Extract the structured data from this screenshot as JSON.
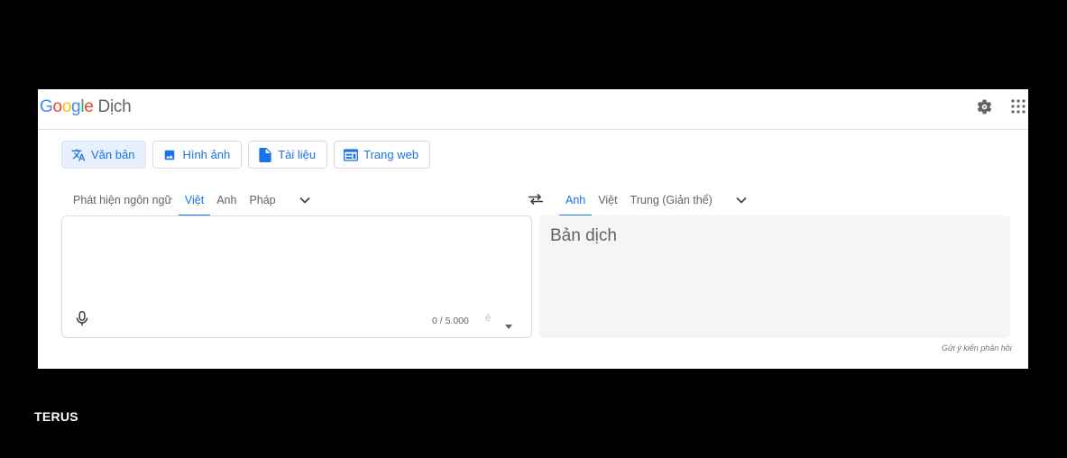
{
  "app": {
    "logo_letters": [
      "G",
      "o",
      "o",
      "g",
      "l",
      "e"
    ],
    "product": "Dịch"
  },
  "header": {
    "settings_icon": "gear-icon",
    "apps_icon": "apps-grid-icon"
  },
  "tabs": [
    {
      "label": "Văn bản",
      "icon": "translate-icon",
      "active": true
    },
    {
      "label": "Hình ảnh",
      "icon": "image-icon",
      "active": false
    },
    {
      "label": "Tài liệu",
      "icon": "document-icon",
      "active": false
    },
    {
      "label": "Trang web",
      "icon": "web-icon",
      "active": false
    }
  ],
  "source_langs": [
    {
      "label": "Phát hiện ngôn ngữ",
      "selected": false
    },
    {
      "label": "Việt",
      "selected": true
    },
    {
      "label": "Anh",
      "selected": false
    },
    {
      "label": "Pháp",
      "selected": false
    }
  ],
  "target_langs": [
    {
      "label": "Anh",
      "selected": true
    },
    {
      "label": "Việt",
      "selected": false
    },
    {
      "label": "Trung (Giản thể)",
      "selected": false
    }
  ],
  "source": {
    "value": "",
    "char_count": "0 / 5.000",
    "ime_glyph": "ê"
  },
  "output": {
    "placeholder": "Bản dịch"
  },
  "feedback": "Gửi ý kiến phản hồi",
  "watermark": "TERUS",
  "colors": {
    "accent": "#1a73e8",
    "active_tab_bg": "#e8f0fe",
    "output_bg": "#f5f5f5"
  }
}
